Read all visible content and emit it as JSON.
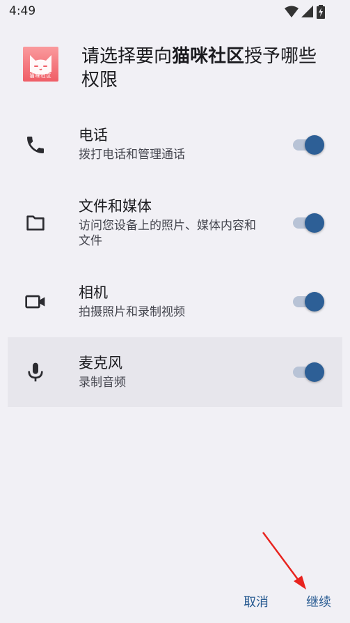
{
  "status_bar": {
    "time": "4:49",
    "icons": [
      "wifi-icon",
      "signal-icon",
      "battery-charging-icon"
    ]
  },
  "header": {
    "title_prefix": "请选择要向",
    "app_name": "猫咪社区",
    "title_suffix": "授予哪些权限",
    "app_icon_text": "猫咪社区"
  },
  "permissions": [
    {
      "icon": "phone-icon",
      "title": "电话",
      "desc": "拨打电话和管理通话",
      "enabled": true
    },
    {
      "icon": "folder-icon",
      "title": "文件和媒体",
      "desc": "访问您设备上的照片、媒体内容和文件",
      "enabled": true
    },
    {
      "icon": "video-camera-icon",
      "title": "相机",
      "desc": "拍摄照片和录制视频",
      "enabled": true
    },
    {
      "icon": "microphone-icon",
      "title": "麦克风",
      "desc": "录制音频",
      "enabled": true
    }
  ],
  "footer": {
    "cancel_label": "取消",
    "continue_label": "继续"
  },
  "colors": {
    "accent": "#2d5f96",
    "background": "#f1f0f5",
    "selected_row": "#e7e6ec",
    "arrow": "#e8231e"
  }
}
